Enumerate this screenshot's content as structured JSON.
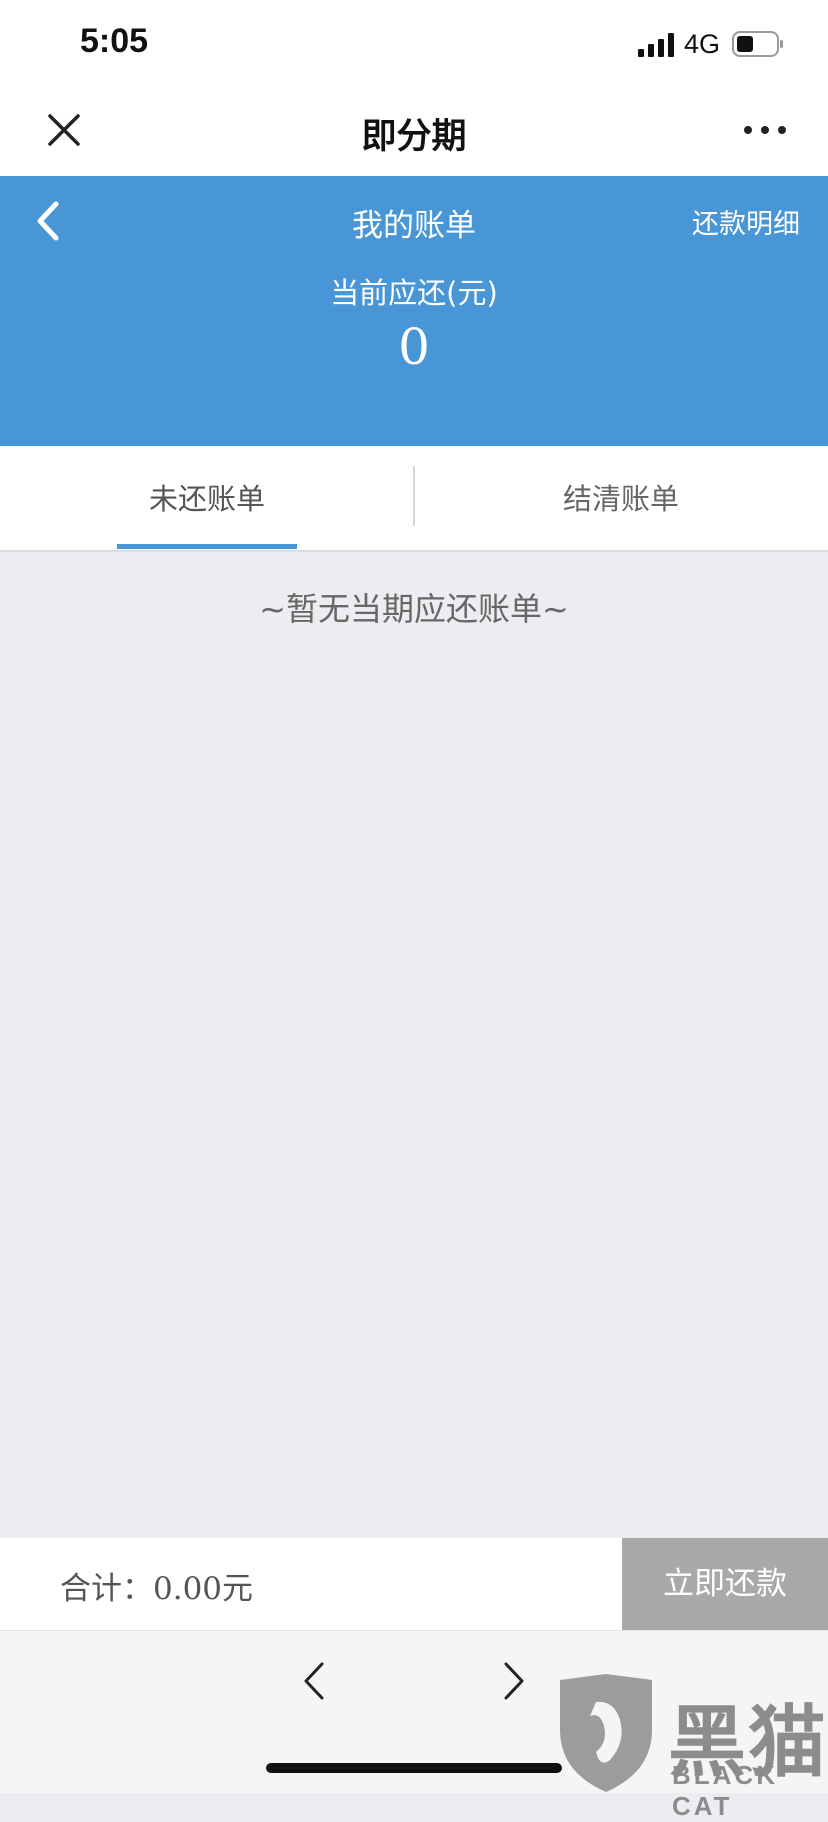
{
  "status_bar": {
    "time": "5:05",
    "network": "4G"
  },
  "nav": {
    "title": "即分期"
  },
  "header": {
    "title": "我的账单",
    "detail_link": "还款明细",
    "due_label": "当前应还(元)",
    "due_amount": "0"
  },
  "tabs": [
    {
      "label": "未还账单",
      "active": true
    },
    {
      "label": "结清账单",
      "active": false
    }
  ],
  "empty_message": "~暂无当期应还账单~",
  "footer": {
    "total_label": "合计：",
    "total_value": "0.00元",
    "pay_button": "立即还款"
  },
  "watermark": {
    "text": "黑猫",
    "sub": "BLACK CAT"
  },
  "colors": {
    "accent": "#4896d6",
    "button_disabled": "#a9a9a9",
    "background": "#ecedf0"
  },
  "icons": [
    "close-icon",
    "more-icon",
    "back-chevron-icon",
    "signal-icon",
    "battery-icon",
    "browser-back-icon",
    "browser-forward-icon"
  ]
}
